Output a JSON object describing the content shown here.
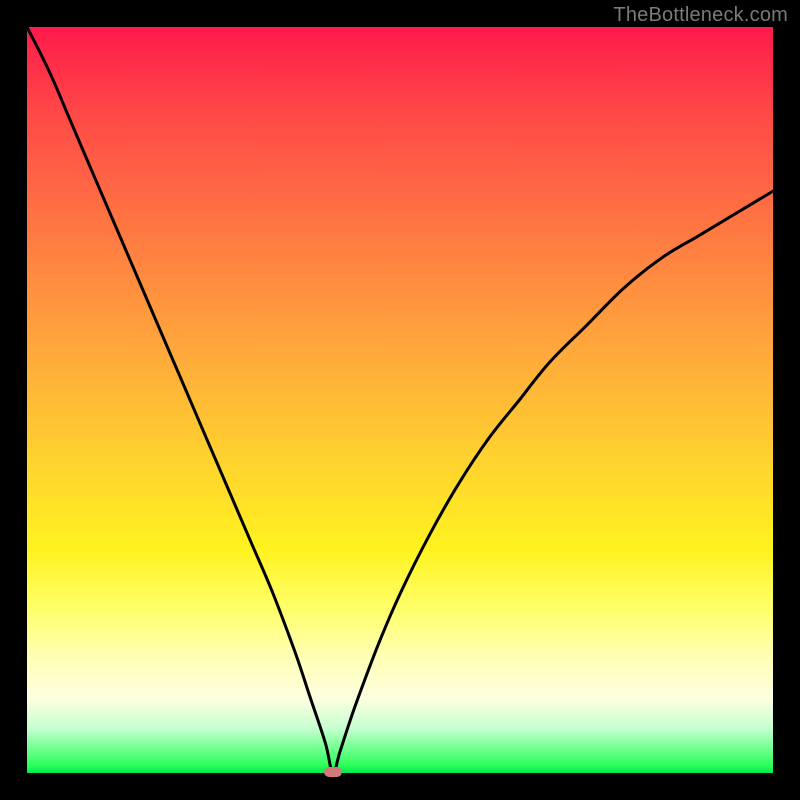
{
  "watermark": "TheBottleneck.com",
  "chart_data": {
    "type": "line",
    "title": "",
    "xlabel": "",
    "ylabel": "",
    "xlim": [
      0,
      100
    ],
    "ylim": [
      0,
      100
    ],
    "grid": false,
    "legend": false,
    "min_marker": {
      "x": 41,
      "y": 0
    },
    "series": [
      {
        "name": "curve",
        "x": [
          0,
          3,
          6,
          9,
          12,
          15,
          18,
          21,
          24,
          27,
          30,
          33,
          36,
          38,
          40,
          41,
          42,
          44,
          47,
          50,
          54,
          58,
          62,
          66,
          70,
          75,
          80,
          85,
          90,
          95,
          100
        ],
        "y": [
          100,
          94,
          87,
          80,
          73,
          66,
          59,
          52,
          45,
          38,
          31,
          24,
          16,
          10,
          4,
          0,
          3,
          9,
          17,
          24,
          32,
          39,
          45,
          50,
          55,
          60,
          65,
          69,
          72,
          75,
          78
        ]
      }
    ],
    "background_gradient": {
      "top": "#ff1a4b",
      "bottom": "#00e84e"
    }
  }
}
